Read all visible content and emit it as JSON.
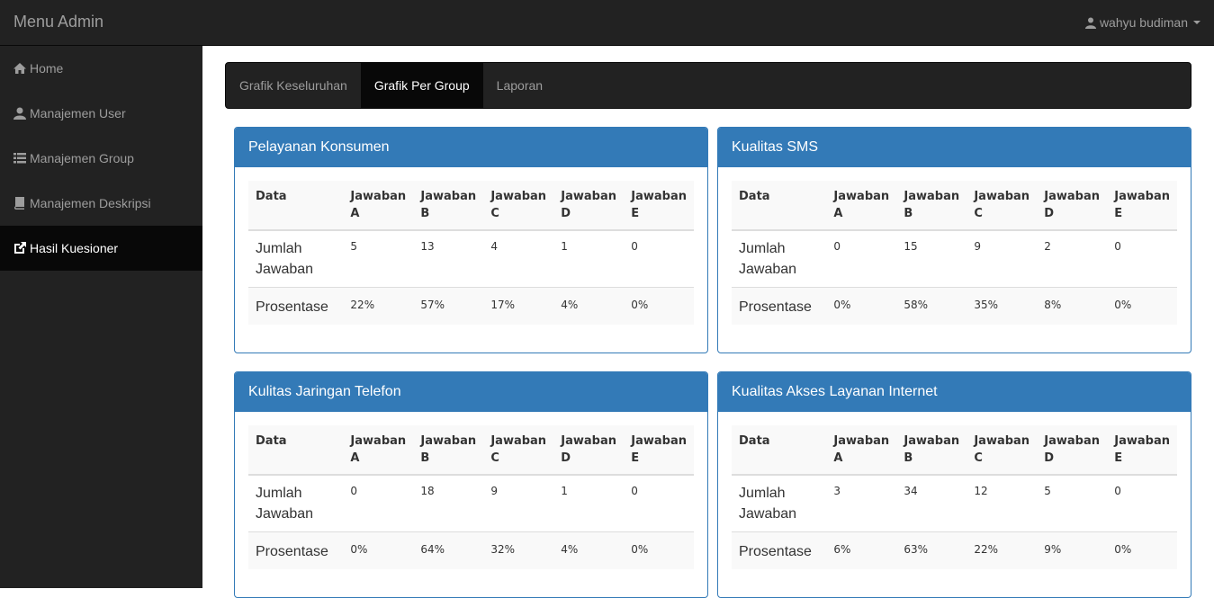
{
  "app": {
    "brand": "Menu Admin",
    "user_name": "wahyu budiman"
  },
  "sidebar": {
    "items": [
      {
        "label": "Home",
        "icon": "home-icon"
      },
      {
        "label": "Manajemen User",
        "icon": "user-icon"
      },
      {
        "label": "Manajemen Group",
        "icon": "list-icon"
      },
      {
        "label": "Manajemen Deskripsi",
        "icon": "book-icon"
      },
      {
        "label": "Hasil Kuesioner",
        "icon": "edit-icon",
        "active": true
      }
    ]
  },
  "tabs": [
    {
      "label": "Grafik Keseluruhan"
    },
    {
      "label": "Grafik Per Group",
      "active": true
    },
    {
      "label": "Laporan"
    }
  ],
  "table_headers": [
    "Data",
    "Jawaban A",
    "Jawaban B",
    "Jawaban C",
    "Jawaban D",
    "Jawaban E"
  ],
  "row_labels": {
    "count": "Jumlah Jawaban",
    "percent": "Prosentase"
  },
  "panels": [
    {
      "title": "Pelayanan Konsumen",
      "counts": [
        "5",
        "13",
        "4",
        "1",
        "0"
      ],
      "percents": [
        "22%",
        "57%",
        "17%",
        "4%",
        "0%"
      ]
    },
    {
      "title": "Kualitas SMS",
      "counts": [
        "0",
        "15",
        "9",
        "2",
        "0"
      ],
      "percents": [
        "0%",
        "58%",
        "35%",
        "8%",
        "0%"
      ]
    },
    {
      "title": "Kulitas Jaringan Telefon",
      "counts": [
        "0",
        "18",
        "9",
        "1",
        "0"
      ],
      "percents": [
        "0%",
        "64%",
        "32%",
        "4%",
        "0%"
      ]
    },
    {
      "title": "Kualitas Akses Layanan Internet",
      "counts": [
        "3",
        "34",
        "12",
        "5",
        "0"
      ],
      "percents": [
        "6%",
        "63%",
        "22%",
        "9%",
        "0%"
      ]
    }
  ],
  "colors": {
    "navbar": "#222222",
    "active": "#080808",
    "primary": "#337ab7"
  }
}
